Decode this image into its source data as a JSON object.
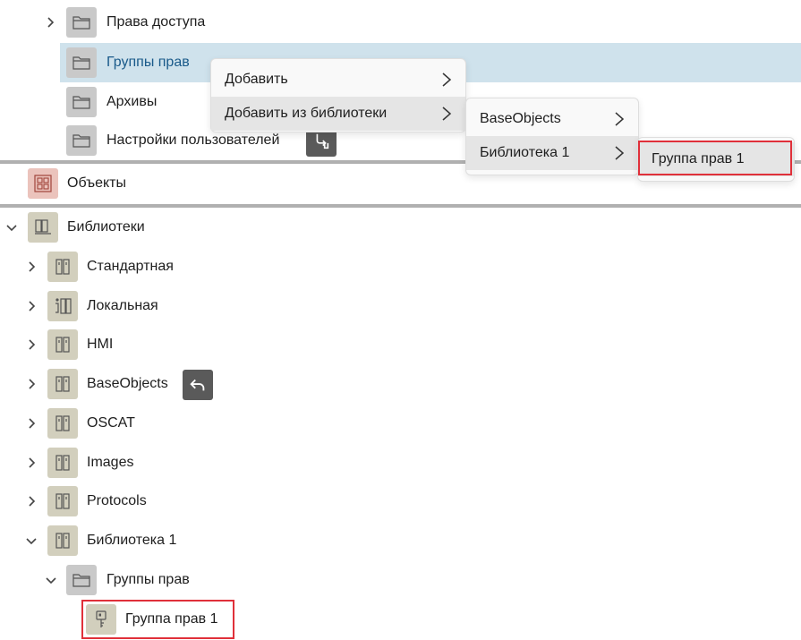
{
  "tree_top": {
    "items": [
      {
        "label": "Права доступа"
      },
      {
        "label": "Группы прав"
      },
      {
        "label": "Архивы"
      },
      {
        "label": "Настройки пользователей"
      }
    ]
  },
  "objects": {
    "label": "Объекты"
  },
  "libraries": {
    "label": "Библиотеки",
    "items": [
      {
        "label": "Стандартная"
      },
      {
        "label": "Локальная"
      },
      {
        "label": "HMI"
      },
      {
        "label": "BaseObjects"
      },
      {
        "label": "OSCAT"
      },
      {
        "label": "Images"
      },
      {
        "label": "Protocols"
      },
      {
        "label": "Библиотека 1"
      }
    ],
    "lib1_children": {
      "folder": {
        "label": "Группы прав"
      },
      "item": {
        "label": "Группа прав 1"
      }
    }
  },
  "context_menu": {
    "items": [
      {
        "label": "Добавить"
      },
      {
        "label": "Добавить из библиотеки"
      }
    ]
  },
  "submenu_libraries": {
    "items": [
      {
        "label": "BaseObjects"
      },
      {
        "label": "Библиотека 1"
      }
    ]
  },
  "submenu_lib1": {
    "items": [
      {
        "label": "Группа прав 1"
      }
    ]
  },
  "colors": {
    "selection": "#cfe2ec",
    "selected_text": "#1a5a8a",
    "highlight_border": "#e0303a",
    "library_icon_bg": "#d2cfbd",
    "objects_icon_bg": "#ebc3bc",
    "folder_icon_bg": "#c9c9c9"
  }
}
